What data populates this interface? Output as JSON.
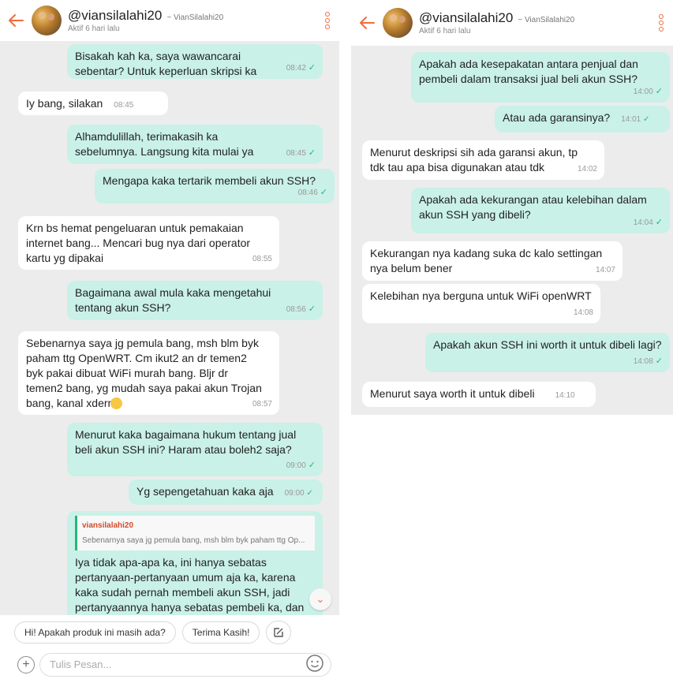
{
  "panel_left": {
    "header": {
      "username": "@viansilalahi20",
      "alias": "~ VianSilalahi20",
      "status": "Aktif 6 hari lalu"
    },
    "messages": [
      {
        "text": "Bisakah kah ka, saya wawancarai sebentar? Untuk keperluan skripsi ka",
        "time": "08:42"
      },
      {
        "text": "Iy bang, silakan",
        "time": "08:45"
      },
      {
        "text": "Alhamdulillah, terimakasih ka sebelumnya. Langsung kita mulai ya",
        "time": "08:45"
      },
      {
        "text": "Mengapa kaka tertarik membeli akun SSH?",
        "time": "08:46"
      },
      {
        "text": "Krn bs hemat pengeluaran untuk pemakaian internet bang... Mencari bug nya dari operator kartu yg dipakai",
        "time": "08:55"
      },
      {
        "text": "Bagaimana awal mula kaka mengetahui tentang akun SSH?",
        "time": "08:56"
      },
      {
        "text": "Sebenarnya saya jg pemula bang, msh blm byk paham ttg OpenWRT. Cm ikut2 an dr temen2 byk pakai dibuat WiFi murah bang. Bljr dr temen2 bang, yg mudah saya pakai akun Trojan bang, kanal xderm",
        "time": "08:57"
      },
      {
        "text": "Menurut kaka bagaimana hukum tentang jual beli akun SSH ini? Haram atau boleh2 saja?",
        "time": "09:00"
      },
      {
        "text": "Yg sepengetahuan kaka aja",
        "time": "09:00"
      },
      {
        "quote_user": "viansilalahi20",
        "quote_text": "Sebenarnya saya jg pemula bang, msh blm byk paham ttg Op...",
        "text": "Iya tidak apa-apa ka, ini hanya sebatas pertanyaan-pertanyaan umum aja ka, karena kaka sudah pernah membeli akun SSH, jadi pertanyaannya hanya sebatas pembeli ka, dan kaka hanya perlu menjawab setau kakak aja"
      }
    ],
    "quick_replies": [
      "Hi! Apakah produk ini masih ada?",
      "Terima Kasih!"
    ],
    "input_placeholder": "Tulis Pesan..."
  },
  "panel_right": {
    "header": {
      "username": "@viansilalahi20",
      "alias": "~ VianSilalahi20",
      "status": "Aktif 6 hari lalu"
    },
    "messages": [
      {
        "text": "Apakah ada kesepakatan antara penjual dan pembeli dalam transaksi jual beli akun SSH?",
        "time": "14:00"
      },
      {
        "text": "Atau ada garansinya?",
        "time": "14:01"
      },
      {
        "text": "Menurut deskripsi sih ada garansi akun, tp tdk tau apa bisa digunakan atau tdk",
        "time": "14:02"
      },
      {
        "text": "Apakah ada kekurangan atau kelebihan dalam akun SSH yang dibeli?",
        "time": "14:04"
      },
      {
        "text": "Kekurangan nya kadang suka dc kalo settingan nya belum bener",
        "time": "14:07"
      },
      {
        "text": "Kelebihan nya berguna untuk WiFi openWRT",
        "time": "14:08"
      },
      {
        "text": "Apakah akun SSH ini worth it untuk dibeli lagi?",
        "time": "14:08"
      },
      {
        "text": "Menurut saya worth it untuk dibeli",
        "time": "14:10"
      }
    ]
  },
  "colors": {
    "accent": "#f26b3a",
    "outgoing_bubble": "#c9f1e7",
    "incoming_bubble": "#ffffff",
    "chat_background": "#ececec",
    "read_tick": "#24b77a"
  }
}
